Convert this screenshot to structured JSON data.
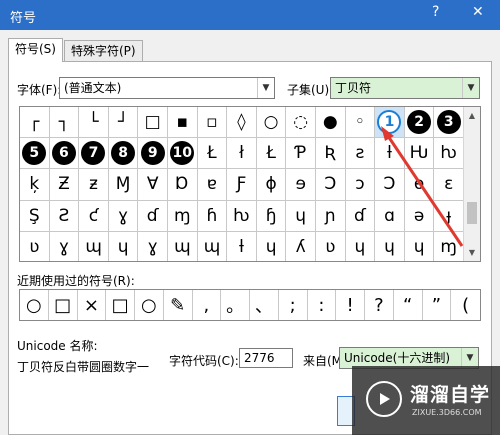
{
  "window": {
    "title": "符号",
    "help": "?",
    "close": "✕"
  },
  "tabs": [
    {
      "label": "符号(S)"
    },
    {
      "label": "特殊字符(P)"
    }
  ],
  "font": {
    "label": "字体(F):",
    "value": "(普通文本)"
  },
  "subset": {
    "label": "子集(U):",
    "value": "丁贝符"
  },
  "grid": {
    "rows": [
      [
        "┌",
        "┐",
        "└",
        "┘",
        "□",
        "▪",
        "▫",
        "◊",
        "○",
        "◌",
        "●",
        "◦",
        "➀",
        "❷",
        "❸",
        "❹"
      ],
      [
        "❺",
        "❻",
        "❼",
        "❽",
        "❾",
        "❿",
        "Ł",
        "ł",
        "Ł",
        "Ƥ",
        "Ʀ",
        "ƨ",
        "ƚ",
        "Ƕ",
        "ƕ",
        "Ķ"
      ],
      [
        "ķ",
        "Ƶ",
        "ƶ",
        "Ɱ",
        "Ɐ",
        "Ɒ",
        "ɐ",
        "Ƒ",
        "ɸ",
        "ɘ",
        "Ɔ",
        "ɔ",
        "Ɔ",
        "ɵ",
        "ɛ",
        "˅"
      ],
      [
        "Ş",
        "Ƨ",
        "ƈ",
        "ɣ",
        "ɗ",
        "ɱ",
        "ɦ",
        "ƕ",
        "ɧ",
        "ɥ",
        "ɲ",
        "ɗ",
        "ɑ",
        "ə",
        "ɟ",
        "ƪ"
      ],
      [
        "ʋ",
        "ɣ",
        "ɰ",
        "ɥ",
        "ɣ",
        "ɰ",
        "ɰ",
        "ƚ",
        "ɥ",
        "ʎ",
        "ʋ",
        "ɥ",
        "ɥ",
        "ɥ",
        "ɱ",
        "ɥ"
      ]
    ],
    "selected_index": 12
  },
  "recent": {
    "label": "近期使用过的符号(R):",
    "symbols": [
      "○",
      "□",
      "×",
      "□",
      "○",
      "✎",
      ",",
      "。",
      "、",
      ";",
      ":",
      "!",
      "?",
      "“",
      "”",
      "("
    ]
  },
  "unicode_name": {
    "label": "Unicode 名称:",
    "value": "丁贝符反白带圆圈数字一"
  },
  "char_code": {
    "label": "字符代码(C):",
    "value": "2776"
  },
  "from": {
    "label": "来自(M):",
    "value": "Unicode(十六进制)"
  },
  "watermark": {
    "name": "溜溜自学",
    "url": "ZIXUE.3D66.COM"
  },
  "colors": {
    "titlebar": "#2b6fc9",
    "highlight": "#d9f1d5",
    "arrow": "#e0392f"
  }
}
